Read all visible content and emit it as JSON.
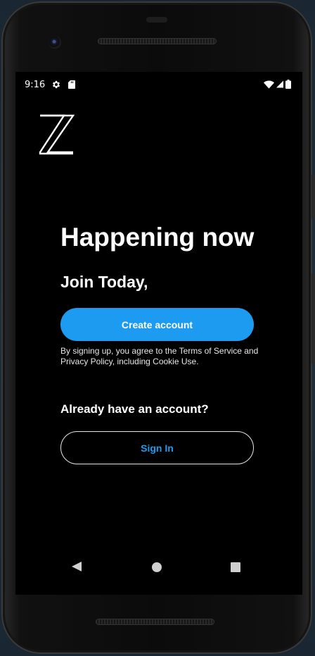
{
  "status_bar": {
    "time": "9:16",
    "left_icons": [
      "gear-icon",
      "sd-card-icon"
    ],
    "right_icons": [
      "wifi-icon",
      "cell-signal-icon",
      "battery-icon"
    ]
  },
  "logo": {
    "icon": "z-logo-icon"
  },
  "main": {
    "headline": "Happening now",
    "subhead": "Join Today,",
    "create_account_label": "Create account",
    "terms_text": "By signing up, you agree to the Terms of Service and Privacy Policy, including Cookie Use.",
    "already_have_account": "Already have an account?",
    "sign_in_label": "Sign In"
  },
  "colors": {
    "accent": "#1d9bf0",
    "background": "#000000",
    "text": "#ffffff"
  },
  "nav_bar": {
    "icons": [
      "back-icon",
      "home-icon",
      "recents-icon"
    ]
  }
}
